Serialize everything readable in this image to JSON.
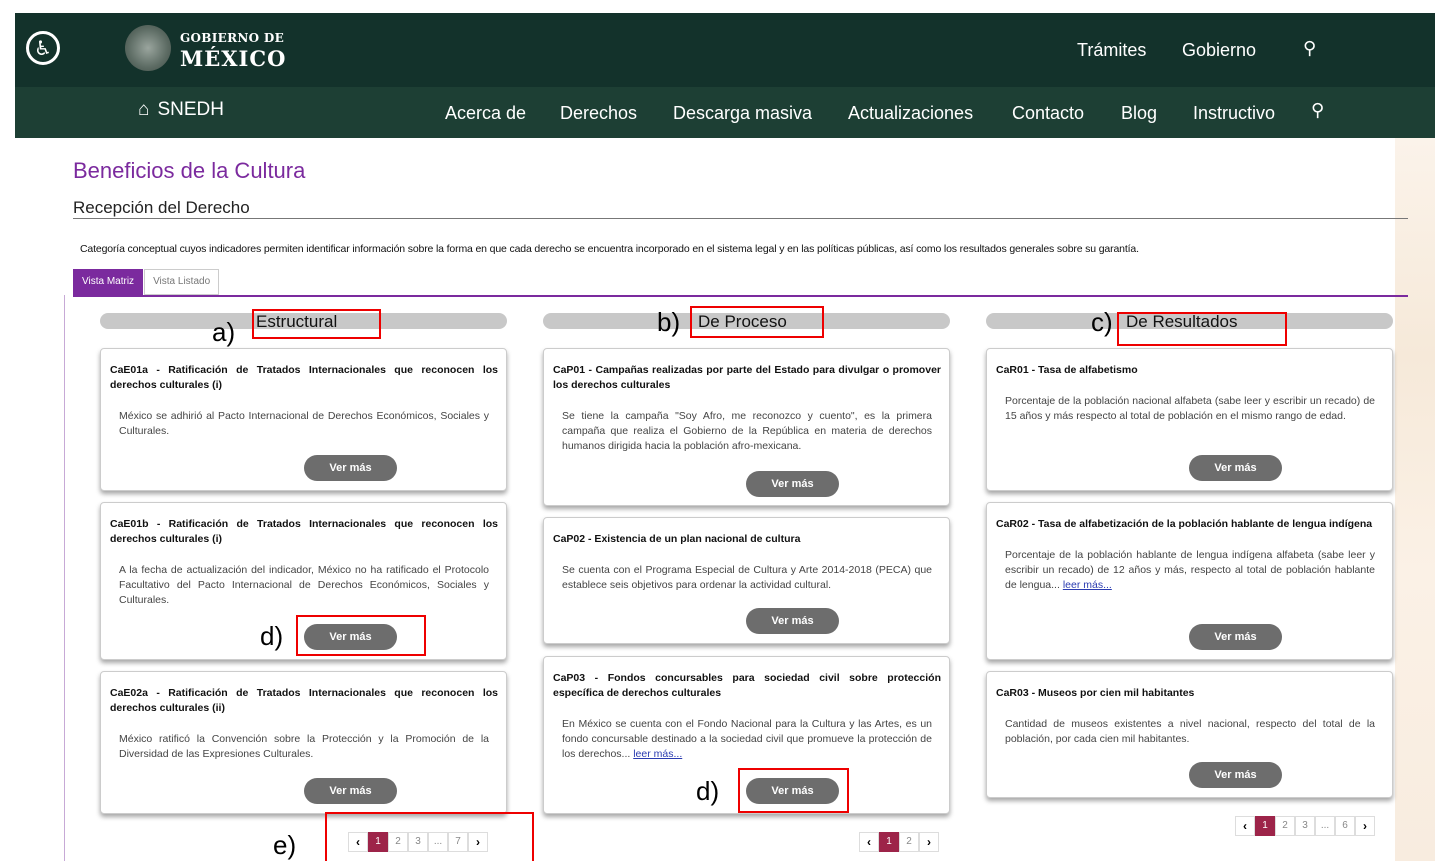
{
  "header": {
    "gob_line1": "GOBIERNO DE",
    "gob_line2": "MÉXICO",
    "top_links": [
      "Trámites",
      "Gobierno"
    ],
    "site_name": "SNEDH",
    "nav": [
      "Acerca de",
      "Derechos",
      "Descarga masiva",
      "Actualizaciones",
      "Contacto",
      "Blog",
      "Instructivo"
    ]
  },
  "page_title": "Beneficios de la Cultura",
  "section_title": "Recepción del Derecho",
  "description": "Categoría conceptual cuyos indicadores permiten identificar información sobre la forma en que cada derecho se encuentra incorporado en el sistema legal y en las políticas públicas, así como los resultados generales sobre su garantía.",
  "tabs": [
    "Vista Matriz",
    "Vista Listado"
  ],
  "columns": [
    {
      "header": "Estructural",
      "annotation": "a)",
      "cards": [
        {
          "title": "CaE01a - Ratificación de Tratados Internacionales que reconocen los derechos culturales (i)",
          "body": "México se adhirió al Pacto Internacional de Derechos Económicos, Sociales y Culturales.",
          "button": "Ver más"
        },
        {
          "title": "CaE01b - Ratificación de Tratados Internacionales que reconocen los derechos culturales (i)",
          "body": "A la fecha de actualización del indicador, México no ha ratificado el Protocolo Facultativo del Pacto Internacional de Derechos Económicos, Sociales y Culturales.",
          "button": "Ver más"
        },
        {
          "title": "CaE02a - Ratificación de Tratados Internacionales que reconocen los derechos culturales (ii)",
          "body": "México ratificó la Convención sobre la Protección y la Promoción de la Diversidad de las Expresiones Culturales.",
          "button": "Ver más"
        }
      ],
      "pager": [
        "‹",
        "1",
        "2",
        "3",
        "...",
        "7",
        "›"
      ]
    },
    {
      "header": "De Proceso",
      "annotation": "b)",
      "cards": [
        {
          "title": "CaP01 - Campañas realizadas por parte del Estado para divulgar o promover los derechos culturales",
          "body": "Se tiene la campaña \"Soy Afro, me reconozco y cuento\", es la primera campaña que realiza el Gobierno de la República en materia de derechos humanos dirigida hacia la población afro-mexicana.",
          "button": "Ver más"
        },
        {
          "title": "CaP02 - Existencia de un plan nacional de cultura",
          "body": "Se cuenta con el Programa Especial de Cultura y Arte 2014-2018 (PECA) que establece seis objetivos para ordenar la actividad cultural.",
          "button": "Ver más"
        },
        {
          "title": "CaP03 - Fondos concursables para sociedad civil sobre protección específica de derechos culturales",
          "body": "En México se cuenta con el Fondo Nacional para la Cultura y las Artes, es un fondo concursable destinado a la sociedad civil que promueve la protección de los derechos...",
          "link": "leer más...",
          "button": "Ver más"
        }
      ],
      "pager": [
        "‹",
        "1",
        "2",
        "›"
      ]
    },
    {
      "header": "De Resultados",
      "annotation": "c)",
      "cards": [
        {
          "title": "CaR01 - Tasa de alfabetismo",
          "body": "Porcentaje de la población nacional alfabeta (sabe leer y escribir un recado) de 15 años y más respecto al total de población en el mismo rango de edad.",
          "button": "Ver más"
        },
        {
          "title": "CaR02 - Tasa de alfabetización de la población hablante de lengua indígena",
          "body": "Porcentaje de la población hablante de lengua indígena alfabeta (sabe leer y escribir un recado) de 12 años y más, respecto al total de población hablante de lengua...",
          "link": "leer más...",
          "button": "Ver más"
        },
        {
          "title": "CaR03 - Museos por cien mil habitantes",
          "body": "Cantidad de museos existentes a nivel nacional, respecto del total de la población, por cada cien mil habitantes.",
          "button": "Ver más"
        }
      ],
      "pager": [
        "‹",
        "1",
        "2",
        "3",
        "...",
        "6",
        "›"
      ]
    }
  ],
  "annotations": {
    "d1": "d)",
    "d2": "d)",
    "e": "e)"
  }
}
